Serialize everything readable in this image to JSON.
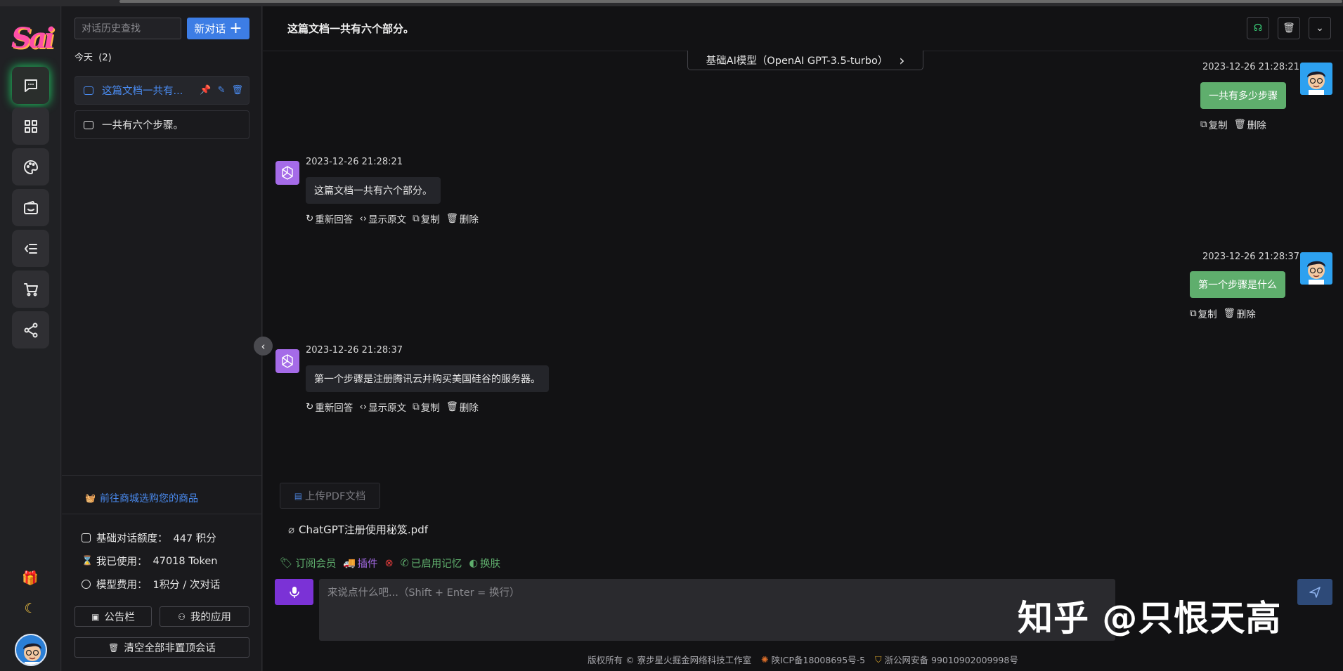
{
  "sidebar": {
    "search_placeholder": "对话历史查找",
    "new_chat_label": "新对话",
    "today_label": "今天",
    "today_count": "(2)",
    "conversations": [
      {
        "title": "这篇文档一共有..."
      },
      {
        "title": "一共有六个步骤。"
      }
    ],
    "mall_link": "前往商城选购您的商品",
    "stats": [
      {
        "label": "基础对话额度：",
        "value": "447 积分"
      },
      {
        "label": "我已使用：",
        "value": "47018 Token"
      },
      {
        "label": "模型费用：",
        "value": "1积分 / 次对话"
      }
    ],
    "notice_label": "公告栏",
    "apps_label": "我的应用",
    "clear_label": "清空全部非置顶会话"
  },
  "header": {
    "title": "这篇文档一共有六个部分。"
  },
  "model_selector": "基础AI模型（OpenAI GPT-3.5-turbo）",
  "messages": [
    {
      "role": "user",
      "time": "2023-12-26 21:28:21",
      "text": "一共有多少步骤",
      "actions": [
        "复制",
        "删除"
      ]
    },
    {
      "role": "ai",
      "time": "2023-12-26 21:28:21",
      "text": "这篇文档一共有六个部分。",
      "actions": [
        "重新回答",
        "显示原文",
        "复制",
        "删除"
      ]
    },
    {
      "role": "user",
      "time": "2023-12-26 21:28:37",
      "text": "第一个步骤是什么",
      "actions": [
        "复制",
        "删除"
      ]
    },
    {
      "role": "ai",
      "time": "2023-12-26 21:28:37",
      "text": "第一个步骤是注册腾讯云并购买美国硅谷的服务器。",
      "actions": [
        "重新回答",
        "显示原文",
        "复制",
        "删除"
      ]
    }
  ],
  "composer": {
    "upload_label": "上传PDF文档",
    "attachment": "ChatGPT注册使用秘笈.pdf",
    "tools": [
      "订阅会员",
      "插件",
      "已启用记忆",
      "换肤"
    ],
    "placeholder": "来说点什么吧...（Shift + Enter = 换行）"
  },
  "footer": {
    "copyright": "版权所有 © 寮步星火掘金网络科技工作室",
    "icp": "陕ICP备18008695号-5",
    "police": "浙公网安备 99010902009998号"
  },
  "watermark": "知乎 @只恨天高",
  "colors": {
    "accent": "#3d7de5",
    "user_bubble": "#5fae6d",
    "active_glow": "#1fdc6b",
    "mic": "#7b32d6"
  }
}
